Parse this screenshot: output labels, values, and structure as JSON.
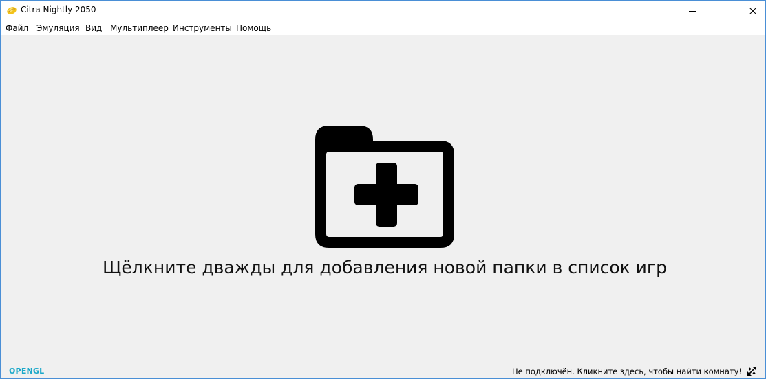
{
  "window": {
    "title": "Citra Nightly 2050"
  },
  "menu": {
    "items": [
      {
        "label": "Файл"
      },
      {
        "label": "Эмуляция"
      },
      {
        "label": "Вид"
      },
      {
        "label": "Мультиплеер"
      },
      {
        "label": "Инструменты"
      },
      {
        "label": "Помощь"
      }
    ]
  },
  "game_list": {
    "empty_hint": "Щёлкните дважды для добавления новой папки в список игр",
    "icon": "folder-plus-icon"
  },
  "statusbar": {
    "renderer": "OPENGL",
    "network_status": "Не подключён. Кликните здесь, чтобы найти комнату!",
    "network_icon": "disconnected-icon"
  },
  "colors": {
    "renderer_text": "#1ba8c9",
    "window_border": "#4a8fd6"
  }
}
